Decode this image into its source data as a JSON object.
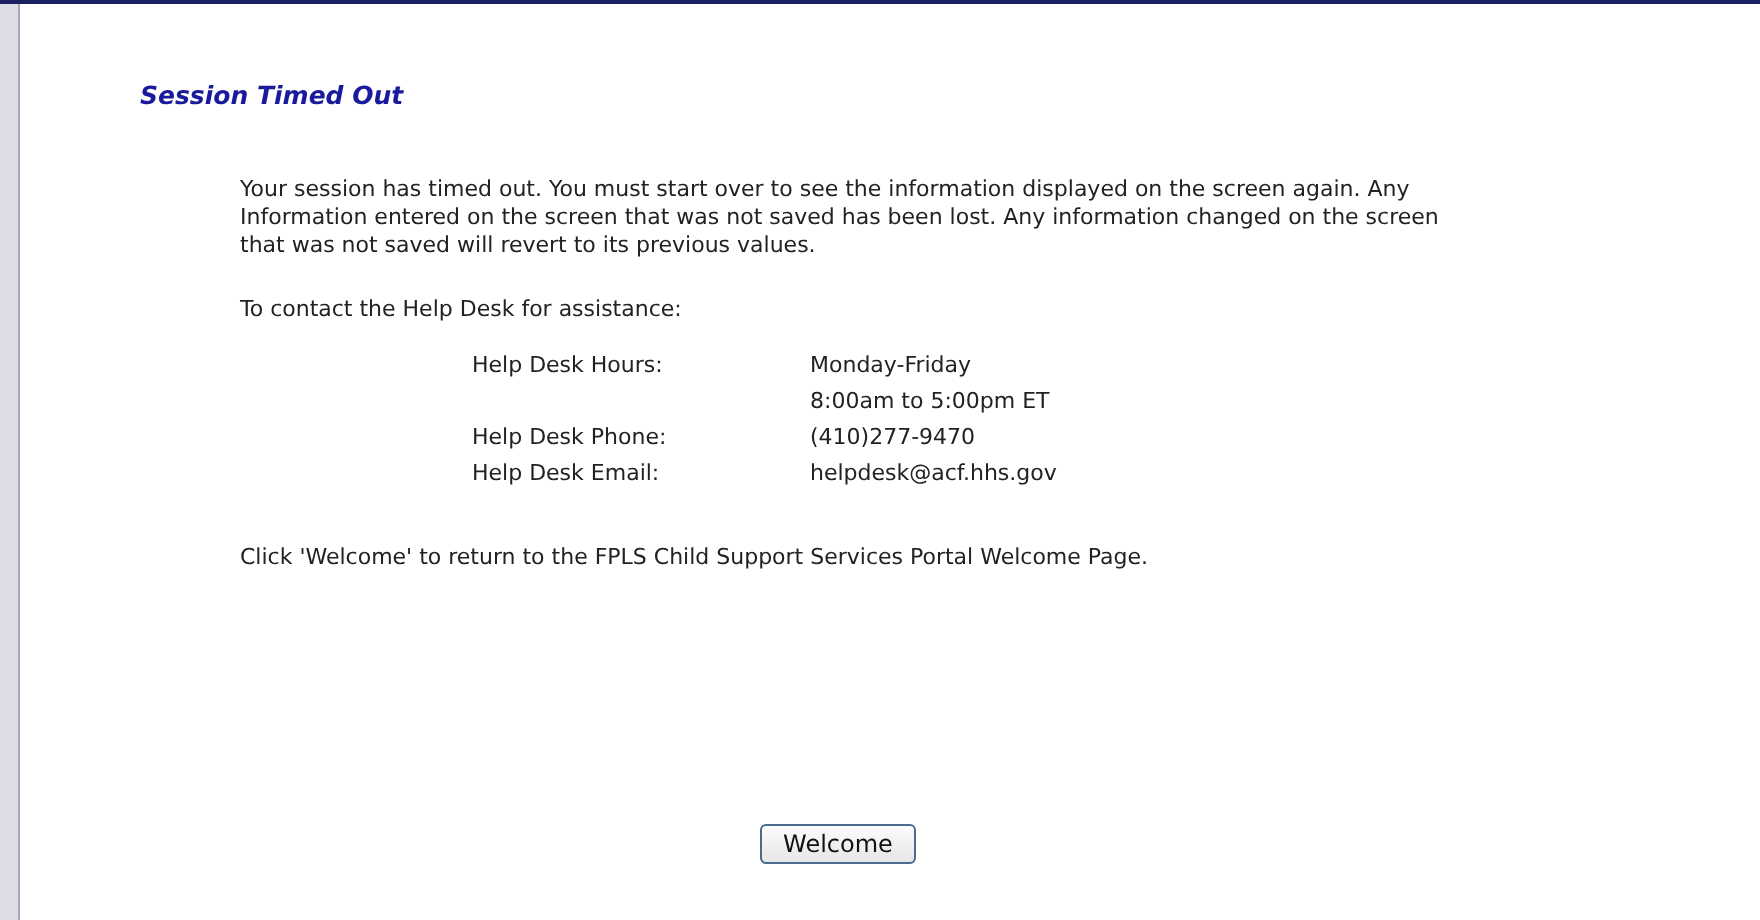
{
  "title": "Session Timed Out",
  "message": "Your session has timed out. You must start over to see the information displayed on the screen again. Any Information entered on the screen that was not saved has been lost. Any information changed on the screen that was not saved will revert to its previous values.",
  "contact_intro": "To contact the Help Desk for assistance:",
  "help_desk": [
    {
      "label": "Help Desk Hours:",
      "values": [
        "Monday-Friday",
        "8:00am to 5:00pm ET"
      ]
    },
    {
      "label": "Help Desk Phone:",
      "values": [
        "(410)277-9470"
      ]
    },
    {
      "label": "Help Desk Email:",
      "values": [
        "helpdesk@acf.hhs.gov"
      ]
    }
  ],
  "return_note": "Click 'Welcome' to return to the FPLS Child Support Services Portal Welcome Page.",
  "button": "Welcome"
}
